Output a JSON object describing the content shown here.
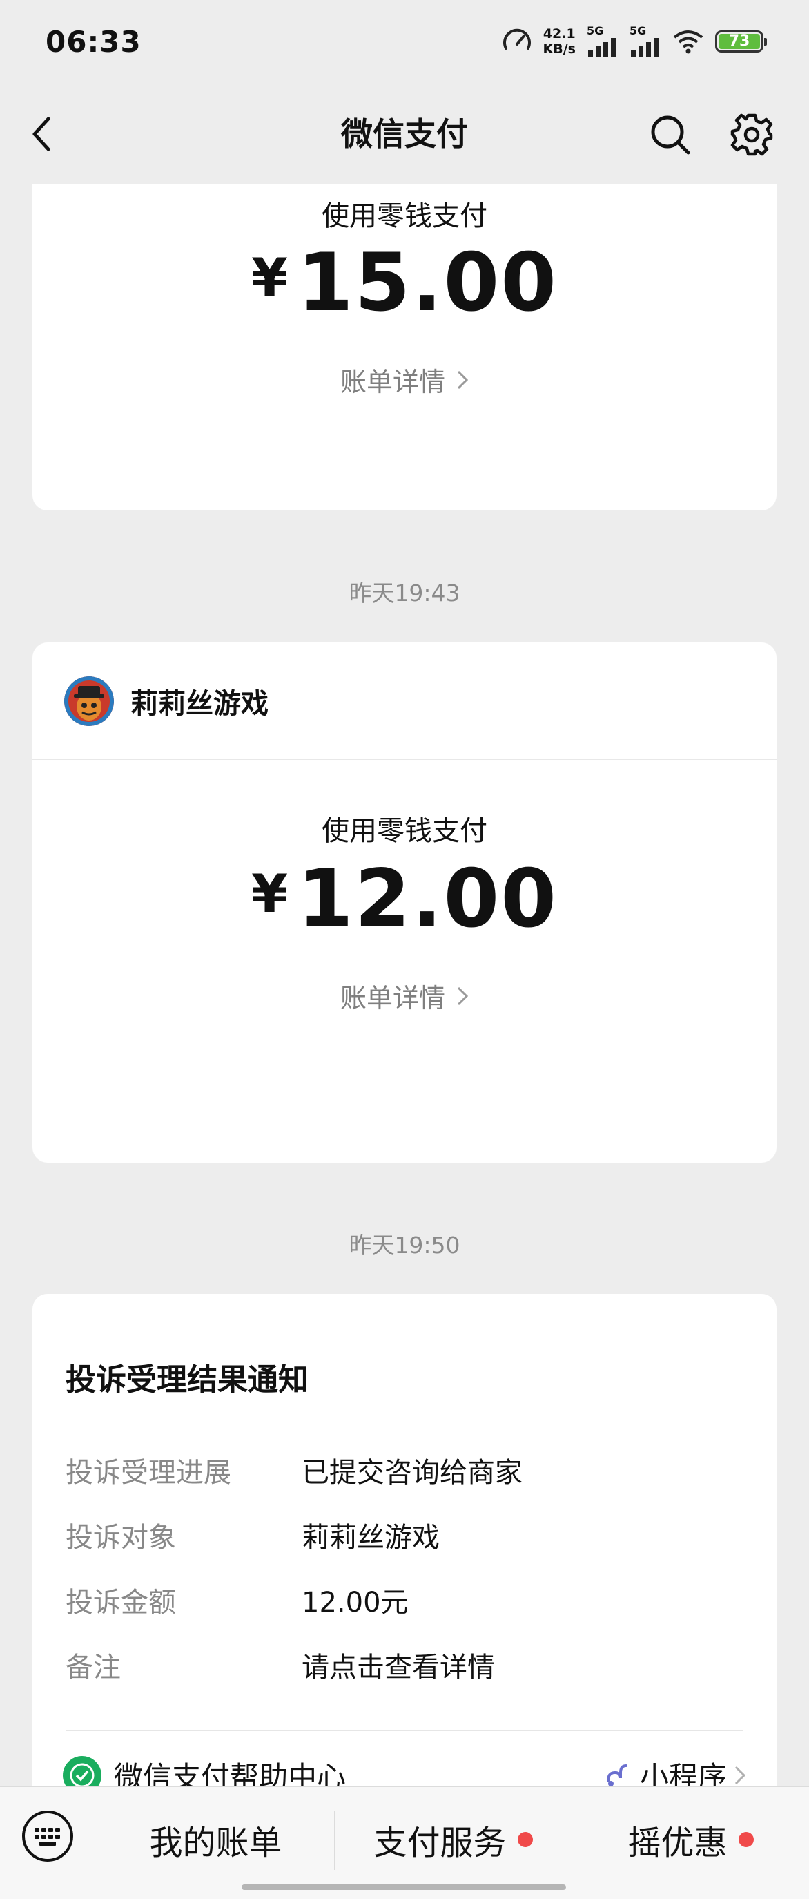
{
  "status_bar": {
    "time": "06:33",
    "speed_value": "42.1",
    "speed_unit": "KB/s",
    "net1": "5G",
    "net2": "5G",
    "battery": "73"
  },
  "navbar": {
    "title": "微信支付",
    "icons": [
      "back-icon",
      "search-icon",
      "gear-icon"
    ]
  },
  "messages": [
    {
      "pay_label": "使用零钱支付",
      "currency": "¥",
      "amount": "15.00",
      "detail_link": "账单详情"
    },
    {
      "timestamp": "昨天19:43",
      "merchant": "莉莉丝游戏",
      "pay_label": "使用零钱支付",
      "currency": "¥",
      "amount": "12.00",
      "detail_link": "账单详情"
    }
  ],
  "notice": {
    "timestamp": "昨天19:50",
    "title": "投诉受理结果通知",
    "rows": [
      {
        "key": "投诉受理进展",
        "value": "已提交咨询给商家"
      },
      {
        "key": "投诉对象",
        "value": "莉莉丝游戏"
      },
      {
        "key": "投诉金额",
        "value": "12.00元"
      },
      {
        "key": "备注",
        "value": "请点击查看详情"
      }
    ],
    "help_center": "微信支付帮助中心",
    "mini_program": "小程序"
  },
  "bottom_menu": {
    "items": [
      "我的账单",
      "支付服务",
      "摇优惠"
    ]
  },
  "colors": {
    "background": "#ededed",
    "card": "#ffffff",
    "red_dot": "#f04a4a",
    "wechat_green": "#1aad5e"
  }
}
